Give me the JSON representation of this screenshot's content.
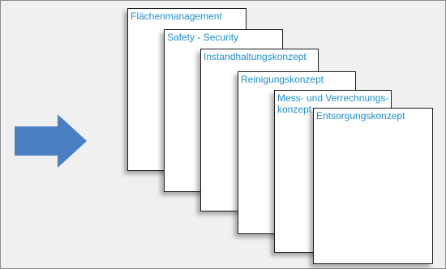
{
  "arrow": {
    "icon": "right-arrow-icon",
    "color": "#4a7fc4"
  },
  "cards": [
    {
      "label": "Flächenmanagement"
    },
    {
      "label": "Safety - Security"
    },
    {
      "label": "Instandhaltungskonzept"
    },
    {
      "label": "Reinigungskonzept"
    },
    {
      "label": "Mess- und Verrechnungs-konzept"
    },
    {
      "label": "Entsorgungskonzept"
    }
  ],
  "colors": {
    "label_text": "#1a8fd0",
    "background": "#f0f0f0",
    "border": "#1e1e1e"
  }
}
